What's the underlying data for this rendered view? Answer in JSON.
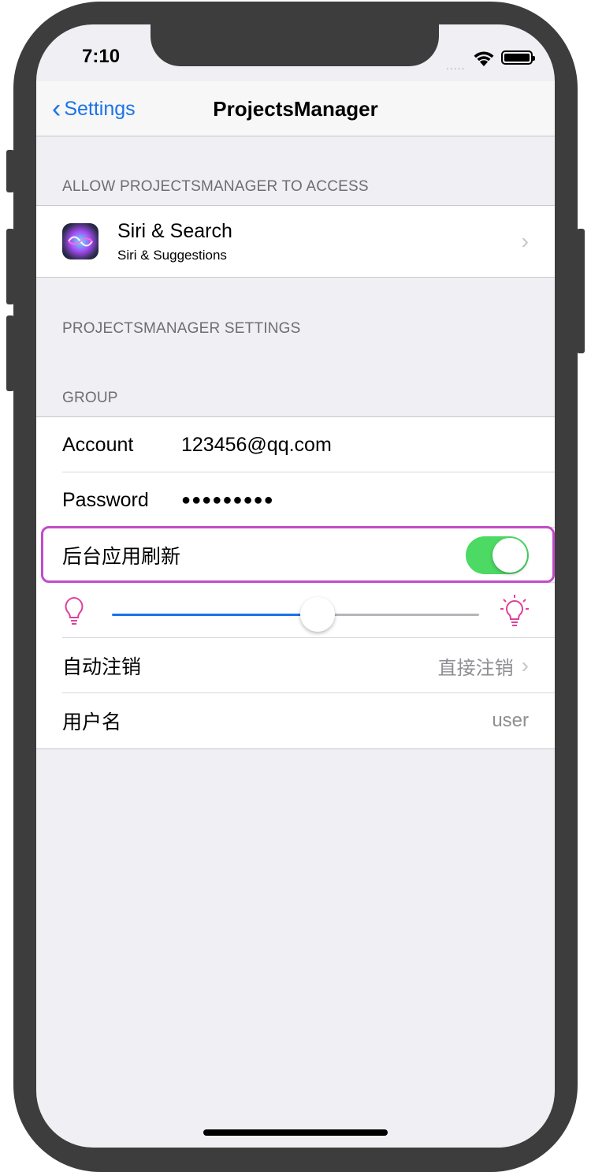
{
  "status": {
    "time": "7:10",
    "signal": "....."
  },
  "nav": {
    "back_label": "Settings",
    "title": "ProjectsManager"
  },
  "section_access": {
    "header": "ALLOW PROJECTSMANAGER TO ACCESS",
    "siri": {
      "title": "Siri & Search",
      "subtitle": "Siri & Suggestions"
    }
  },
  "section_settings": {
    "header": "PROJECTSMANAGER SETTINGS"
  },
  "section_group": {
    "header": "GROUP",
    "account": {
      "label": "Account",
      "value": "123456@qq.com"
    },
    "password": {
      "label": "Password",
      "value": "●●●●●●●●●"
    },
    "background_refresh": {
      "label": "后台应用刷新",
      "on": true
    },
    "brightness": {
      "value_fraction": 0.56
    },
    "auto_logout": {
      "label": "自动注销",
      "detail": "直接注销"
    },
    "username": {
      "label": "用户名",
      "detail": "user"
    }
  },
  "colors": {
    "accent": "#1a73e8",
    "toggle_on": "#4cd964",
    "highlight": "#c24bc9",
    "bulb": "#e0409a"
  }
}
